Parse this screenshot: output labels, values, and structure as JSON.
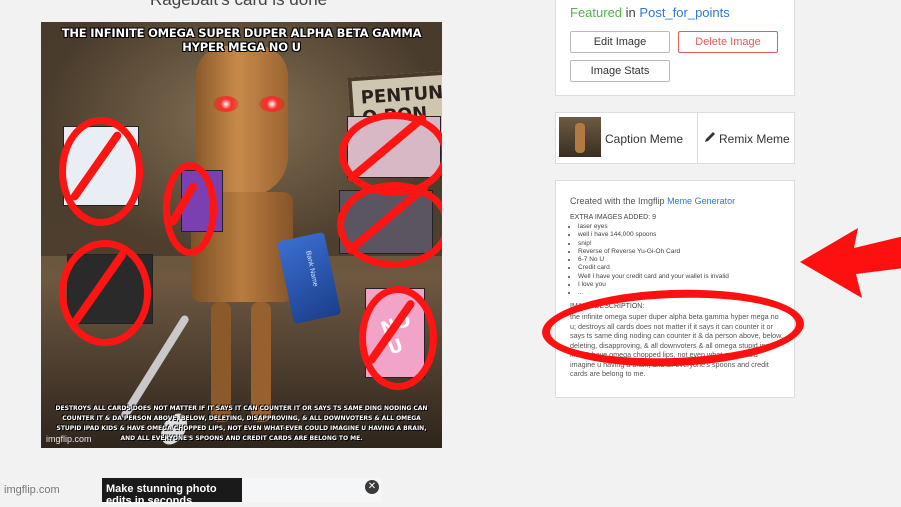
{
  "page": {
    "title": "Ragebait's card is done"
  },
  "meme": {
    "caption_top": "THE INFINITE OMEGA SUPER DUPER ALPHA BETA GAMMA HYPER MEGA NO U",
    "caption_bottom": "DESTROYS ALL CARDS DOES NOT MATTER IF IT SAYS IT CAN COUNTER IT OR SAYS TS SAME DING NODING CAN COUNTER IT & DA PERSON ABOVE, BELOW, DELETING, DISAPPROVING, & ALL DOWNVOTERS & ALL OMEGA STUPID IPAD KIDS & HAVE OMEGA CHOPPED LIPS, NOT EVEN WHAT-EVER COULD IMAGINE U HAVING A BRAIN, AND ALL EVERYONE'S SPOONS AND CREDIT CARDS ARE BELONG TO ME.",
    "watermark": "imgflip.com",
    "sign_text": "PENTUNG O PON",
    "card_text": "Bank Name",
    "spoons_tag": "well i have 144,000 spoons",
    "no_u_text": "NO U"
  },
  "featured": {
    "label": "Featured",
    "in": "in",
    "stream": "Post_for_points"
  },
  "actions": {
    "edit": "Edit Image",
    "delete": "Delete Image",
    "stats": "Image Stats"
  },
  "share": {
    "caption": "Caption Meme",
    "remix": "Remix Meme"
  },
  "info": {
    "created_prefix": "Created with the Imgflip",
    "generator_link": "Meme Generator",
    "extra_header": "EXTRA IMAGES ADDED: 9",
    "extra_items": [
      "laser eyes",
      "well i have 144,000 spoons",
      "snip!",
      "Reverse of Reverse Yu-Gi-Oh Card",
      "6-7 No U",
      "Credit card",
      "Well I have your credit card and your wallet is invalid",
      "I love you",
      "..."
    ],
    "desc_header": "IMAGE DESCRIPTION:",
    "description": "the infinite omega super duper alpha beta gamma hyper mega no u; destroys all cards does not matter if it says it can counter it or says ts same ding noding can counter it & da person above, below, deleting, disapproving, & all downvoters & all omega stupid ipad kids & have omega chopped lips, not even what-ever could imagine u having a brain, and all everyone's spoons and credit cards are belong to me."
  },
  "footer": {
    "watermark": "imgflip.com",
    "ad_text": "Make stunning photo edits in seconds",
    "ad_close": "✕"
  },
  "colors": {
    "red_marker": "#ff1010",
    "link": "#2a7bd1",
    "featured_green": "#55b14a",
    "delete_red": "#e55a5a"
  }
}
